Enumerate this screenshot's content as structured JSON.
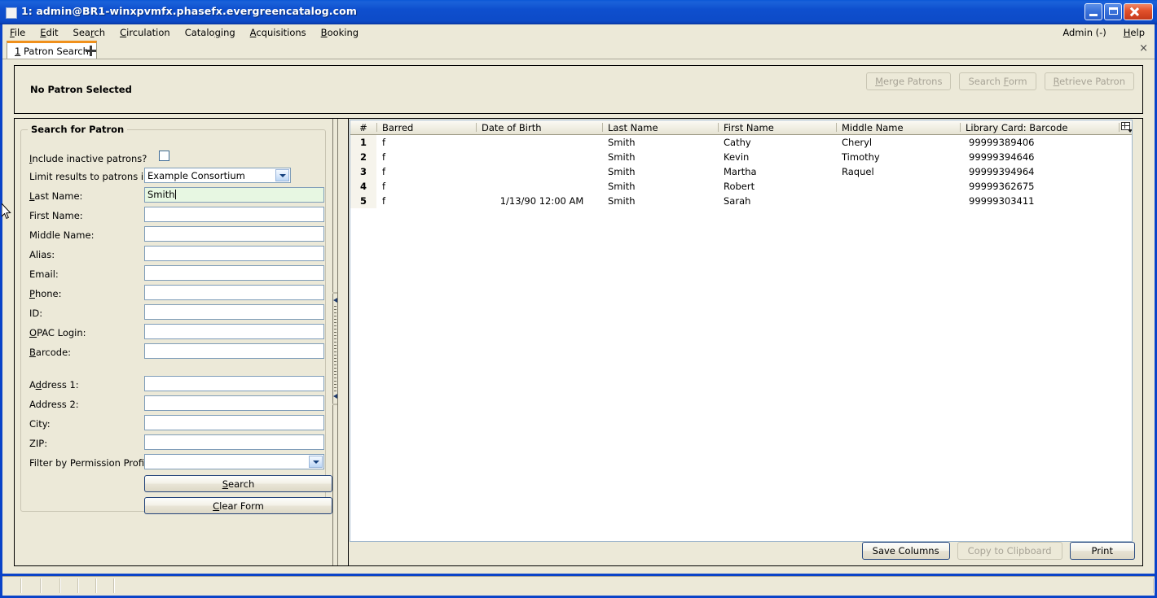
{
  "window": {
    "title": "1: admin@BR1-winxpvmfx.phasefx.evergreencatalog.com",
    "icon": "window-icon",
    "minimize_label": "Minimize",
    "maximize_label": "Maximize",
    "close_label": "Close"
  },
  "menubar": {
    "items": [
      {
        "label": "File",
        "accel": "F"
      },
      {
        "label": "Edit",
        "accel": "E"
      },
      {
        "label": "Search",
        "accel": "r"
      },
      {
        "label": "Circulation",
        "accel": "C"
      },
      {
        "label": "Cataloging",
        "accel": "g"
      },
      {
        "label": "Acquisitions",
        "accel": "A"
      },
      {
        "label": "Booking",
        "accel": "B"
      }
    ],
    "right_items": [
      {
        "label": "Admin (-)",
        "accel": ""
      },
      {
        "label": "Help",
        "accel": "H"
      }
    ]
  },
  "tabs": {
    "items": [
      {
        "number": "1",
        "label": "Patron Search",
        "active": true
      }
    ],
    "new_tab_label": "+",
    "close_all_label": "×"
  },
  "patron_bar": {
    "status": "No Patron Selected",
    "buttons": [
      {
        "label": "Merge Patrons",
        "accel": "M",
        "disabled": true
      },
      {
        "label": "Search Form",
        "accel": "F",
        "disabled": true
      },
      {
        "label": "Retrieve Patron",
        "accel": "R",
        "disabled": true
      }
    ]
  },
  "search_form": {
    "legend": "Search for Patron",
    "include_inactive": {
      "label": "Include inactive patrons?",
      "accel": "I",
      "checked": false
    },
    "limit_results": {
      "label": "Limit results to patrons in",
      "value": "Example Consortium"
    },
    "fields": [
      {
        "label": "Last Name:",
        "accel": "L",
        "value": "Smith",
        "placeholder": "",
        "focused": true
      },
      {
        "label": "First Name:",
        "accel": "",
        "value": "",
        "placeholder": "",
        "focused": false
      },
      {
        "label": "Middle Name:",
        "accel": "",
        "value": "",
        "placeholder": "",
        "focused": false
      },
      {
        "label": "Alias:",
        "accel": "",
        "value": "",
        "placeholder": "",
        "focused": false
      },
      {
        "label": "Email:",
        "accel": "",
        "value": "",
        "placeholder": "",
        "focused": false
      },
      {
        "label": "Phone:",
        "accel": "P",
        "value": "",
        "placeholder": "",
        "focused": false
      },
      {
        "label": "ID:",
        "accel": "",
        "value": "",
        "placeholder": "",
        "focused": false
      },
      {
        "label": "OPAC Login:",
        "accel": "O",
        "value": "",
        "placeholder": "",
        "focused": false
      },
      {
        "label": "Barcode:",
        "accel": "B",
        "value": "",
        "placeholder": "",
        "focused": false
      }
    ],
    "address_fields": [
      {
        "label": "Address 1:",
        "accel": "d",
        "value": "",
        "placeholder": ""
      },
      {
        "label": "Address 2:",
        "accel": "",
        "value": "",
        "placeholder": ""
      },
      {
        "label": "City:",
        "accel": "",
        "value": "",
        "placeholder": ""
      },
      {
        "label": "ZIP:",
        "accel": "",
        "value": "",
        "placeholder": ""
      }
    ],
    "permission_profile": {
      "label": "Filter by Permission Profile:",
      "value": ""
    },
    "search_button": "Search",
    "search_accel": "S",
    "clear_button": "Clear Form",
    "clear_accel": "C"
  },
  "results": {
    "columns": [
      "#",
      "Barred",
      "Date of Birth",
      "Last Name",
      "First Name",
      "Middle Name",
      "Library Card: Barcode"
    ],
    "column_picker_icon": "column-picker-icon",
    "rows": [
      {
        "num": "1",
        "barred": "f",
        "dob": "",
        "last": "Smith",
        "first": "Cathy",
        "middle": "Cheryl",
        "barcode": "99999389406"
      },
      {
        "num": "2",
        "barred": "f",
        "dob": "",
        "last": "Smith",
        "first": "Kevin",
        "middle": "Timothy",
        "barcode": "99999394646"
      },
      {
        "num": "3",
        "barred": "f",
        "dob": "",
        "last": "Smith",
        "first": "Martha",
        "middle": "Raquel",
        "barcode": "99999394964"
      },
      {
        "num": "4",
        "barred": "f",
        "dob": "",
        "last": "Smith",
        "first": "Robert",
        "middle": "",
        "barcode": "99999362675"
      },
      {
        "num": "5",
        "barred": "f",
        "dob": "1/13/90 12:00 AM",
        "last": "Smith",
        "first": "Sarah",
        "middle": "",
        "barcode": "99999303411"
      }
    ],
    "buttons": [
      {
        "label": "Save Columns",
        "disabled": false
      },
      {
        "label": "Copy to Clipboard",
        "disabled": true
      },
      {
        "label": "Print",
        "disabled": false
      }
    ]
  },
  "statusbar": {
    "segments": [
      "",
      "",
      "",
      "",
      "",
      "",
      ""
    ]
  },
  "colors": {
    "titlebar_blue": "#0d4bc8",
    "chrome_beige": "#ece9d8",
    "active_tab_accent": "#f0901b",
    "field_focus_green": "#e7f7e2",
    "field_border": "#7f9db9"
  }
}
